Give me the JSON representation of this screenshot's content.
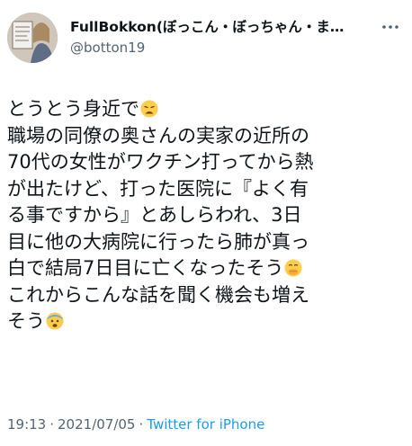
{
  "tweet": {
    "author": {
      "display_name": "FullBokkon(ぼっこん・ぼっちゃん・ま…",
      "handle": "@botton19",
      "avatar_icon": "profile-photo"
    },
    "more_icon": "more-dots-icon",
    "lines": [
      "とうとう身近で",
      "職場の同僚の奥さんの実家の近所の",
      "70代の女性がワクチン打ってから熱",
      "が出たけど、打った医院に『よく有",
      "る事ですから』とあしらわれ、3日",
      "目に他の大病院に行ったら肺が真っ",
      "白で結局7日目に亡くなったそう",
      "これからこんな話を聞く機会も増え",
      "そう"
    ],
    "emojis": {
      "line_1": "weary-face-emoji",
      "line_7": "face-with-hand-over-mouth-emoji",
      "line_9": "fearful-face-emoji"
    },
    "time": "19:13",
    "separator": "·",
    "date": "2021/07/05",
    "source": "Twitter for iPhone",
    "colors": {
      "text": "#0f1419",
      "secondary": "#536471",
      "link": "#1d9bf0",
      "emoji_yellow": "#ffcc4d"
    }
  }
}
